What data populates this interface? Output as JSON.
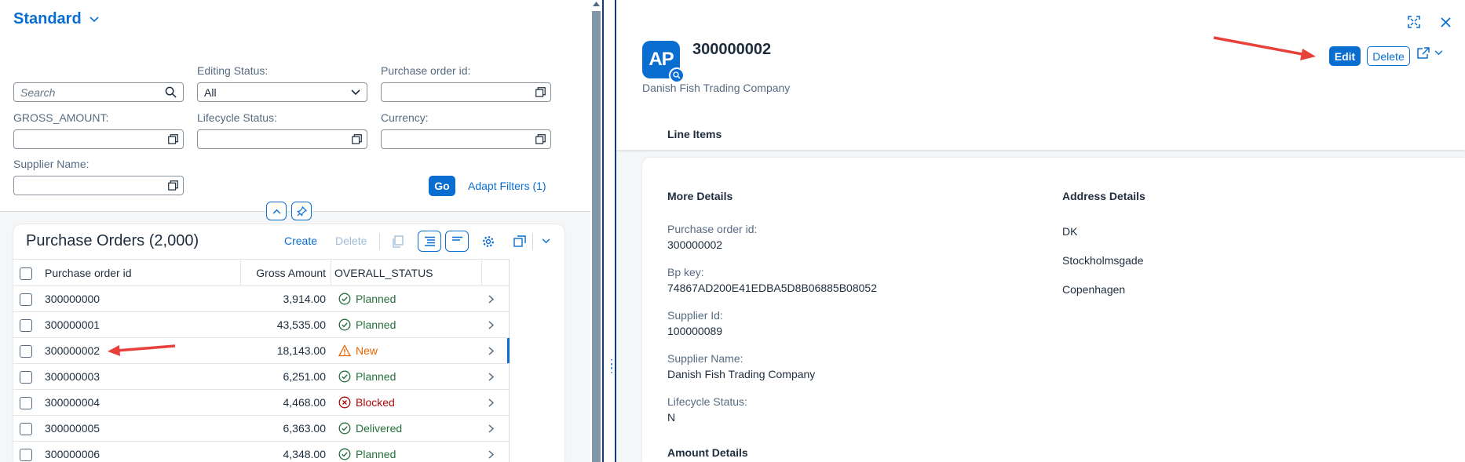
{
  "filterbar": {
    "variant": "Standard",
    "search": {
      "placeholder": "Search"
    },
    "editing_status": {
      "label": "Editing Status:",
      "value": "All"
    },
    "po_id": {
      "label": "Purchase order id:"
    },
    "gross_amount": {
      "label": "GROSS_AMOUNT:"
    },
    "lifecycle": {
      "label": "Lifecycle Status:"
    },
    "currency": {
      "label": "Currency:"
    },
    "supplier": {
      "label": "Supplier Name:"
    },
    "go": "Go",
    "adapt": "Adapt Filters (1)"
  },
  "table": {
    "title": "Purchase Orders (2,000)",
    "create": "Create",
    "delete": "Delete",
    "columns": [
      "Purchase order id",
      "Gross Amount",
      "OVERALL_STATUS"
    ],
    "rows": [
      {
        "id": "300000000",
        "amount": "3,914.00",
        "status": "Planned",
        "kind": "ok"
      },
      {
        "id": "300000001",
        "amount": "43,535.00",
        "status": "Planned",
        "kind": "ok"
      },
      {
        "id": "300000002",
        "amount": "18,143.00",
        "status": "New",
        "kind": "warn"
      },
      {
        "id": "300000003",
        "amount": "6,251.00",
        "status": "Planned",
        "kind": "ok"
      },
      {
        "id": "300000004",
        "amount": "4,468.00",
        "status": "Blocked",
        "kind": "err"
      },
      {
        "id": "300000005",
        "amount": "6,363.00",
        "status": "Delivered",
        "kind": "ok"
      },
      {
        "id": "300000006",
        "amount": "4,348.00",
        "status": "Planned",
        "kind": "ok"
      }
    ]
  },
  "object": {
    "avatar": "AP",
    "title": "300000002",
    "subtitle": "Danish Fish Trading Company",
    "edit": "Edit",
    "delete": "Delete",
    "anchor_tab": "Line Items",
    "more_details": {
      "title": "More Details",
      "fields": [
        {
          "label": "Purchase order id:",
          "value": "300000002"
        },
        {
          "label": "Bp key:",
          "value": "74867AD200E41EDBA5D8B06885B08052"
        },
        {
          "label": "Supplier Id:",
          "value": "100000089"
        },
        {
          "label": "Supplier Name:",
          "value": "Danish Fish Trading Company"
        },
        {
          "label": "Lifecycle Status:",
          "value": "N"
        }
      ]
    },
    "address_details": {
      "title": "Address Details",
      "lines": [
        "DK",
        "Stockholmsgade",
        "Copenhagen"
      ]
    },
    "amount_details": {
      "title": "Amount Details"
    }
  },
  "colors": {
    "accent": "#0a6ed1",
    "positive": "#256f3a",
    "critical": "#e76500",
    "negative": "#aa0808",
    "annotation": "#e8403a"
  }
}
